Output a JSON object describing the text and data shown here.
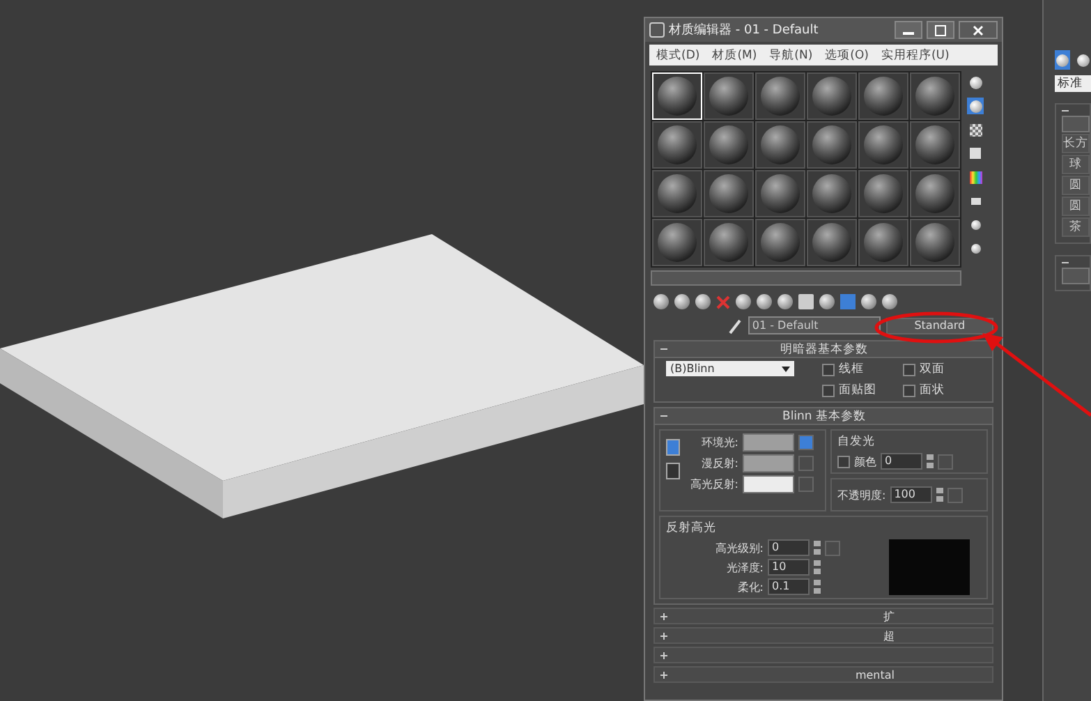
{
  "editor": {
    "title": "材质编辑器 - 01 - Default",
    "menu": [
      "模式(D)",
      "材质(M)",
      "导航(N)",
      "选项(O)",
      "实用程序(U)"
    ],
    "slots": [
      {
        "selected": true
      },
      {
        "selected": false
      },
      {
        "selected": false
      },
      {
        "selected": false
      },
      {
        "selected": false
      },
      {
        "selected": false
      },
      {
        "selected": false
      },
      {
        "selected": false
      },
      {
        "selected": false
      },
      {
        "selected": false
      },
      {
        "selected": false
      },
      {
        "selected": false
      },
      {
        "selected": false
      },
      {
        "selected": false
      },
      {
        "selected": false
      },
      {
        "selected": false
      },
      {
        "selected": false
      },
      {
        "selected": false
      },
      {
        "selected": false
      },
      {
        "selected": false
      },
      {
        "selected": false
      },
      {
        "selected": false
      },
      {
        "selected": false
      },
      {
        "selected": false
      }
    ],
    "material_name": "01 - Default",
    "material_type": "Standard",
    "shader_rollout": {
      "title": "明暗器基本参数",
      "shader": "(B)Blinn",
      "options": [
        {
          "label": "线框",
          "checked": false
        },
        {
          "label": "双面",
          "checked": false
        },
        {
          "label": "面贴图",
          "checked": false
        },
        {
          "label": "面状",
          "checked": false
        }
      ]
    },
    "blinn_rollout": {
      "title": "Blinn 基本参数",
      "colors": [
        {
          "label": "环境光:",
          "color": "#9e9e9e"
        },
        {
          "label": "漫反射:",
          "color": "#9e9e9e"
        },
        {
          "label": "高光反射:",
          "color": "#ececec"
        }
      ],
      "self_illum": {
        "title": "自发光",
        "label": "颜色",
        "checked": false,
        "value": "0"
      },
      "opacity": {
        "label": "不透明度:",
        "value": "100"
      },
      "specular": {
        "title": "反射高光",
        "fields": [
          {
            "label": "高光级别:",
            "value": "0"
          },
          {
            "label": "光泽度:",
            "value": "10"
          },
          {
            "label": "柔化:",
            "value": "0.1"
          }
        ]
      }
    },
    "collapsed_rollouts": [
      {
        "title": "扩",
        "expanded": false
      },
      {
        "title": "超",
        "expanded": false
      },
      {
        "expanded": false
      },
      {
        "title": "mental",
        "expanded": false
      }
    ]
  },
  "command_panel": {
    "dropdown": "标准",
    "buttons": [
      "长方",
      "球",
      "圆",
      "圆",
      "茶"
    ]
  }
}
